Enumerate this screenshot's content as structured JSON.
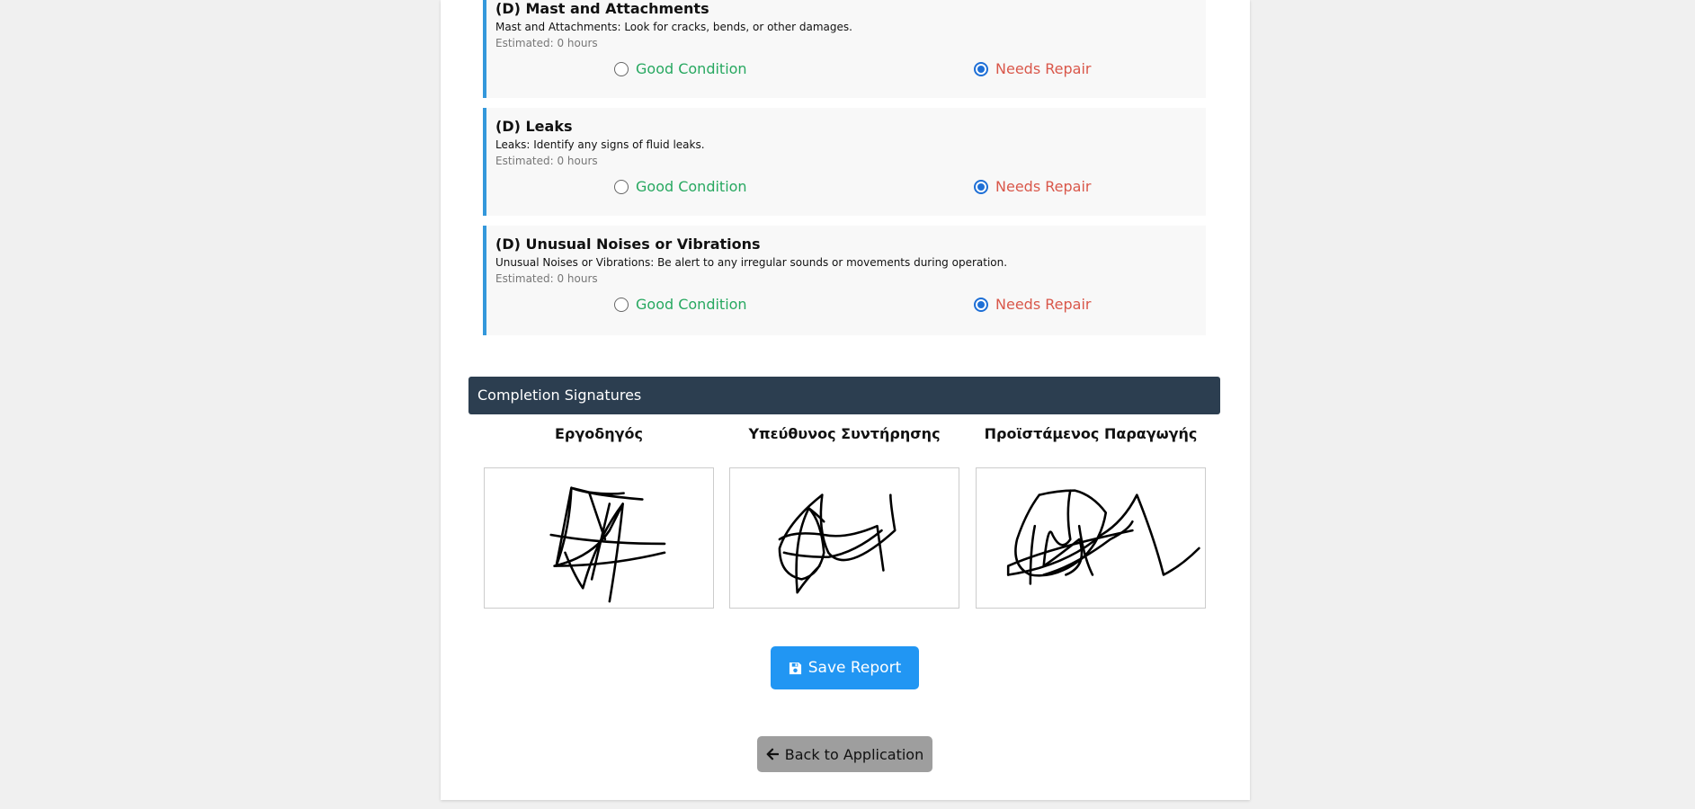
{
  "checklist": {
    "items": [
      {
        "title": "(D) Mast and Attachments",
        "description": "Mast and Attachments: Look for cracks, bends, or other damages.",
        "estimated": "Estimated: 0 hours",
        "good_label": "Good Condition",
        "repair_label": "Needs Repair",
        "selected": "repair"
      },
      {
        "title": "(D) Leaks",
        "description": "Leaks: Identify any signs of fluid leaks.",
        "estimated": "Estimated: 0 hours",
        "good_label": "Good Condition",
        "repair_label": "Needs Repair",
        "selected": "repair"
      },
      {
        "title": "(D) Unusual Noises or Vibrations",
        "description": "Unusual Noises or Vibrations: Be alert to any irregular sounds or movements during operation.",
        "estimated": "Estimated: 0 hours",
        "good_label": "Good Condition",
        "repair_label": "Needs Repair",
        "selected": "repair"
      }
    ]
  },
  "signatures": {
    "header": "Completion Signatures",
    "roles": [
      "Εργοδηγός",
      "Υπεύθυνος Συντήρησης",
      "Προϊστάμενος Παραγωγής"
    ]
  },
  "actions": {
    "save_label": "Save Report",
    "save_icon": "floppy-disk-icon",
    "back_label": "Back to Application",
    "back_icon": "arrow-left-icon"
  },
  "colors": {
    "accent_border": "#3498db",
    "good": "#27a860",
    "repair": "#d9574a",
    "header_bg": "#2c3e50",
    "save_bg": "#2196f3",
    "back_bg": "#9e9e9e"
  }
}
